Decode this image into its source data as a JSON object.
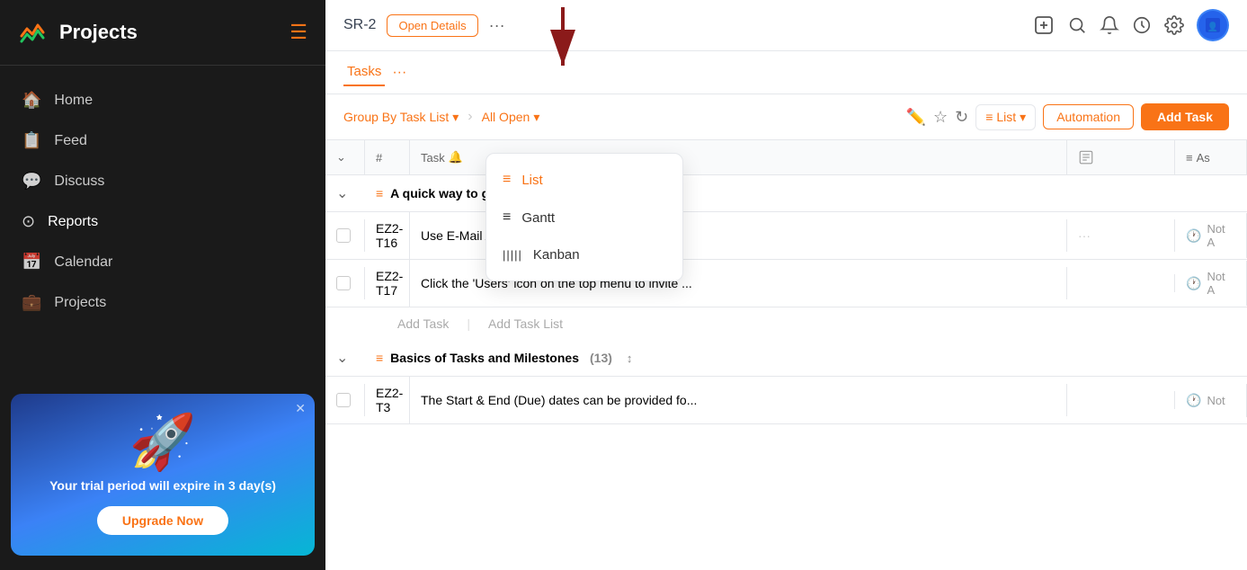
{
  "sidebar": {
    "title": "Projects",
    "nav_items": [
      {
        "id": "home",
        "label": "Home",
        "icon": "🏠"
      },
      {
        "id": "feed",
        "label": "Feed",
        "icon": "📋"
      },
      {
        "id": "discuss",
        "label": "Discuss",
        "icon": "💬"
      },
      {
        "id": "reports",
        "label": "Reports",
        "icon": "⊙"
      },
      {
        "id": "calendar",
        "label": "Calendar",
        "icon": "📅"
      },
      {
        "id": "projects",
        "label": "Projects",
        "icon": "💼"
      }
    ],
    "trial": {
      "text": "Your trial period will expire in 3 day(s)",
      "upgrade_label": "Upgrade Now",
      "close_label": "✕"
    }
  },
  "topbar": {
    "task_id": "SR-2",
    "open_details_label": "Open Details",
    "dots": "···",
    "add_icon": "⊞",
    "search_icon": "🔍",
    "bell_icon": "🔔",
    "clock_icon": "🕐",
    "gear_icon": "⚙"
  },
  "tabs": {
    "active_tab": "Tasks",
    "more_label": "···"
  },
  "filter_bar": {
    "group_by_label": "Group By Task List",
    "all_open_label": "All Open",
    "list_label": "List",
    "automation_label": "Automation",
    "add_task_label": "Add Task"
  },
  "table": {
    "headers": [
      "",
      "#",
      "Task",
      "",
      ""
    ],
    "groups": [
      {
        "id": "group1",
        "name": "A quick way to get starte...",
        "rows": [
          {
            "id": "EZ2-T16",
            "task": "Use E-Mail Alias to add st...",
            "status": "Not A"
          },
          {
            "id": "EZ2-T17",
            "task": "Click the 'Users' icon on the top menu to invite ...",
            "status": "Not A"
          }
        ]
      },
      {
        "id": "group2",
        "name": "Basics of Tasks and Milestones",
        "count": "(13)",
        "rows": [
          {
            "id": "EZ2-T3",
            "task": "The Start & End (Due) dates can be provided fo...",
            "status": "Not"
          }
        ]
      }
    ],
    "add_task_label": "Add Task",
    "add_task_list_label": "Add Task List"
  },
  "dropdown": {
    "items": [
      {
        "id": "list",
        "label": "List",
        "icon": "≡",
        "active": true
      },
      {
        "id": "gantt",
        "label": "Gantt",
        "icon": "≡"
      },
      {
        "id": "kanban",
        "label": "Kanban",
        "icon": "|||"
      }
    ]
  }
}
